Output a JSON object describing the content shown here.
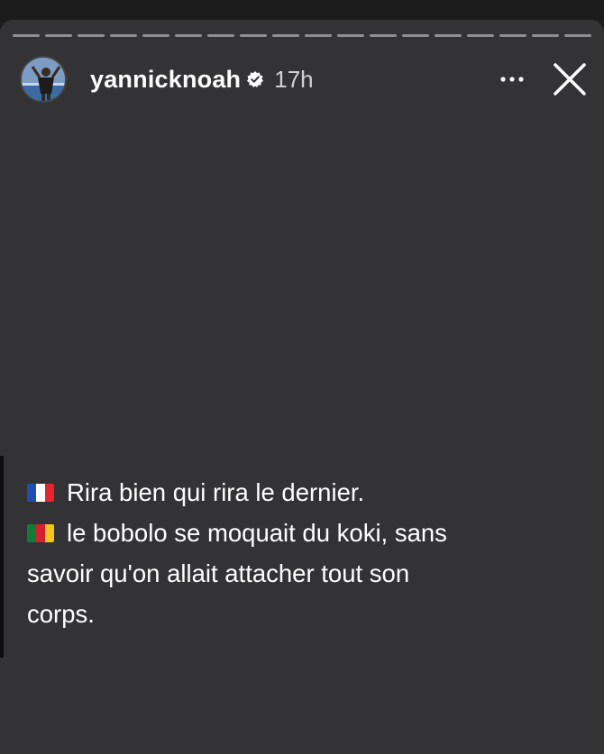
{
  "story": {
    "progress_segments": 18,
    "username": "yannicknoah",
    "time_ago": "17h",
    "icons": {
      "avatar": "profile-photo",
      "verified": "verified-badge-icon",
      "more": "more-options-icon",
      "close": "close-icon"
    }
  },
  "caption": {
    "line1_flag": "flag-france",
    "line1_text": "Rira bien qui rira le dernier.",
    "line2_flag": "flag-cameroon",
    "line2_text": "le bobolo se moquait du koki, sans",
    "line3_text": "savoir qu'on allait attacher tout son",
    "line4_text": "corps."
  },
  "colors": {
    "background": "#333335",
    "text": "#ffffff",
    "france": [
      "#1f4fae",
      "#ffffff",
      "#e4252f"
    ],
    "cameroon": [
      "#137a3a",
      "#d6202b",
      "#f4c61d"
    ]
  }
}
